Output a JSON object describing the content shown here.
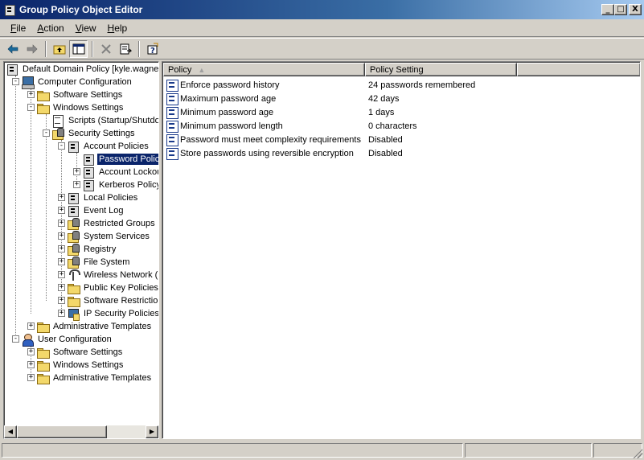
{
  "window": {
    "title": "Group Policy Object Editor",
    "controls": {
      "minimize": "_",
      "maximize": "□",
      "close": "X"
    }
  },
  "menu": [
    {
      "label": "File",
      "accel": "F",
      "rest": "ile"
    },
    {
      "label": "Action",
      "accel": "A",
      "rest": "ction"
    },
    {
      "label": "View",
      "accel": "V",
      "rest": "iew"
    },
    {
      "label": "Help",
      "accel": "H",
      "rest": "elp"
    }
  ],
  "toolbar": {
    "buttons": [
      "back-arrow-icon",
      "forward-arrow-icon",
      "up-one-level-icon",
      "show-hide-tree-icon",
      "delete-icon",
      "export-list-icon",
      "help-icon"
    ]
  },
  "tree": {
    "root": "Default Domain Policy [kyle.wagner",
    "computer_configuration": "Computer Configuration",
    "cc_software_settings": "Software Settings",
    "cc_windows_settings": "Windows Settings",
    "scripts": "Scripts (Startup/Shutdo",
    "security_settings": "Security Settings",
    "account_policies": "Account Policies",
    "password_policy": "Password Policy",
    "account_lockout": "Account Lockou",
    "kerberos_policy": "Kerberos Policy",
    "local_policies": "Local Policies",
    "event_log": "Event Log",
    "restricted_groups": "Restricted Groups",
    "system_services": "System Services",
    "registry": "Registry",
    "file_system": "File System",
    "wireless_network": "Wireless Network (I",
    "public_key_policies": "Public Key Policies",
    "software_restriction": "Software Restrictio",
    "ip_security_policies": "IP Security Policies",
    "cc_administrative_templates": "Administrative Templates",
    "user_configuration": "User Configuration",
    "uc_software_settings": "Software Settings",
    "uc_windows_settings": "Windows Settings",
    "uc_administrative_templates": "Administrative Templates"
  },
  "list": {
    "columns": [
      "Policy",
      "Policy Setting"
    ],
    "sort_arrow": "▲",
    "rows": [
      {
        "policy": "Enforce password history",
        "setting": "24 passwords remembered"
      },
      {
        "policy": "Maximum password age",
        "setting": "42 days"
      },
      {
        "policy": "Minimum password age",
        "setting": "1 days"
      },
      {
        "policy": "Minimum password length",
        "setting": "0 characters"
      },
      {
        "policy": "Password must meet complexity requirements",
        "setting": "Disabled"
      },
      {
        "policy": "Store passwords using reversible encryption",
        "setting": "Disabled"
      }
    ]
  },
  "scrollbar": {
    "left_arrow": "◀",
    "right_arrow": "▶"
  },
  "colors": {
    "title_start": "#0a246a",
    "title_end": "#a6caf0",
    "selection": "#0a246a",
    "face": "#d4d0c8"
  }
}
